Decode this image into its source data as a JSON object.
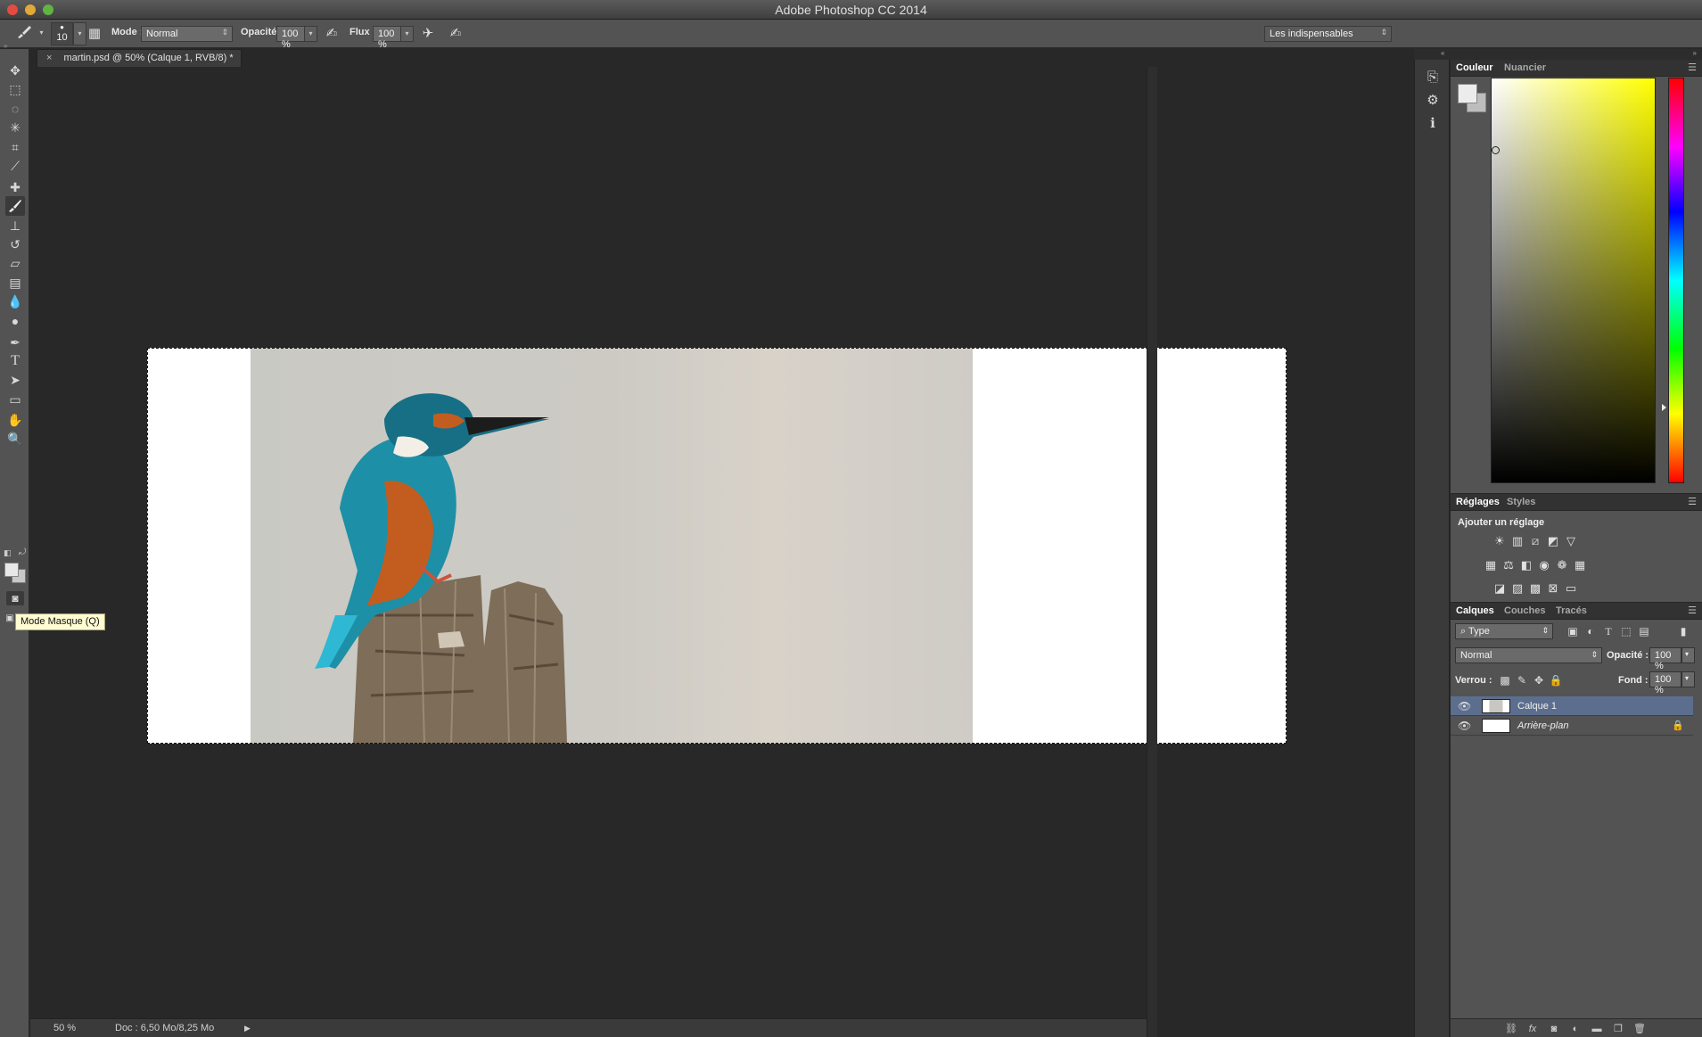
{
  "window": {
    "title": "Adobe Photoshop CC 2014"
  },
  "options_bar": {
    "brush_size": "10",
    "mode_label": "Mode :",
    "mode_value": "Normal",
    "opacity_label": "Opacité :",
    "opacity_value": "100 %",
    "flow_label": "Flux :",
    "flow_value": "100 %",
    "workspace": "Les indispensables"
  },
  "document": {
    "tab_title": "martin.psd @ 50% (Calque 1, RVB/8) *",
    "close_glyph": "×"
  },
  "toolbar": {
    "tooltip": "Mode Masque (Q)"
  },
  "status_bar": {
    "zoom": "50 %",
    "doc_info": "Doc : 6,50 Mo/8,25 Mo"
  },
  "color_panel": {
    "tabs": [
      "Couleur",
      "Nuancier"
    ],
    "foreground_color": "#ececec",
    "background_color": "#bdbdbd"
  },
  "adjustments_panel": {
    "tabs": [
      "Réglages",
      "Styles"
    ],
    "title": "Ajouter un réglage"
  },
  "layers_panel": {
    "tabs": [
      "Calques",
      "Couches",
      "Tracés"
    ],
    "filter_kind": "Type",
    "blend_mode": "Normal",
    "opacity_label": "Opacité :",
    "opacity_value": "100 %",
    "lock_label": "Verrou :",
    "fill_label": "Fond :",
    "fill_value": "100 %",
    "layers": [
      {
        "name": "Calque 1",
        "selected": true
      },
      {
        "name": "Arrière-plan",
        "selected": false,
        "locked": true
      }
    ]
  },
  "colors": {
    "selected_layer": "#5c6e8d",
    "panel_bg": "#535353",
    "canvas_bg": "#282828"
  }
}
